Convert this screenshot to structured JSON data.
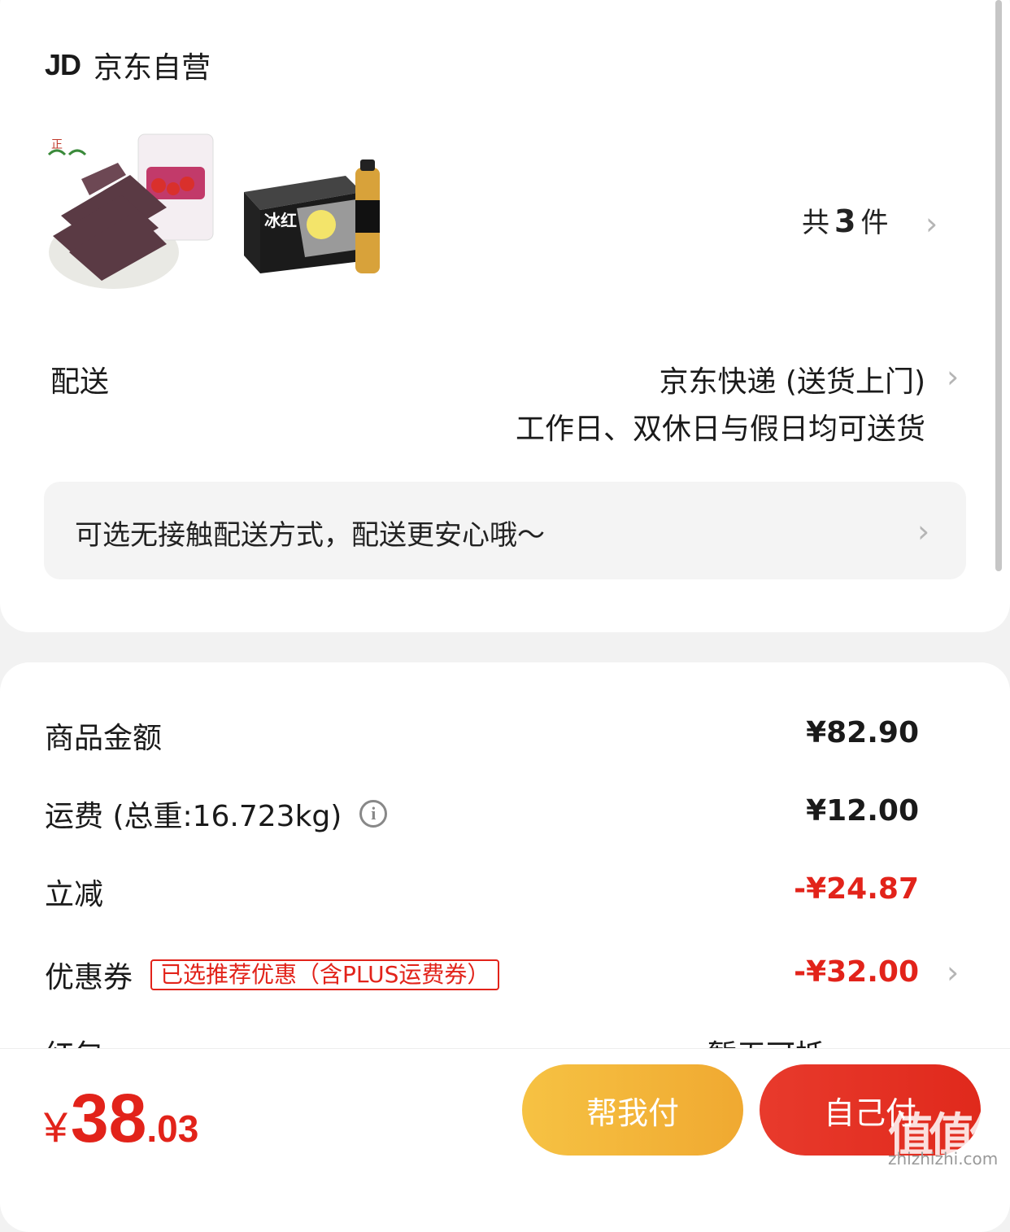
{
  "shop": {
    "logo": "JD",
    "name": "京东自营"
  },
  "products": {
    "count_prefix": "共",
    "count": "3",
    "count_suffix": "件",
    "item1_icon": "hawthorn-snack-product-image",
    "item2_icon": "ice-tea-case-product-image"
  },
  "delivery": {
    "label": "配送",
    "method": "京东快递 (送货上门)",
    "schedule": "工作日、双休日与假日均可送货"
  },
  "notice": {
    "text": "可选无接触配送方式，配送更安心哦～"
  },
  "costs": {
    "goods_label": "商品金额",
    "goods_value": "¥82.90",
    "shipping_label": "运费 (总重:16.723kg)",
    "shipping_value": "¥12.00",
    "discount_label": "立减",
    "discount_value": "-¥24.87",
    "coupon_label": "优惠券",
    "coupon_tag": "已选推荐优惠（含PLUS运费券）",
    "coupon_value": "-¥32.00",
    "cut_left": "红包",
    "cut_right": "暂无可抵"
  },
  "footer": {
    "currency": "¥",
    "total_int": "38",
    "total_dec": ".03",
    "help_pay": "帮我付",
    "self_pay": "自己付",
    "watermark": "值值值",
    "watermark_url": "zhizhizhi.com"
  },
  "colors": {
    "accent": "#e2231a",
    "help_button": "#f3b63a",
    "self_button": "#e3301f"
  }
}
